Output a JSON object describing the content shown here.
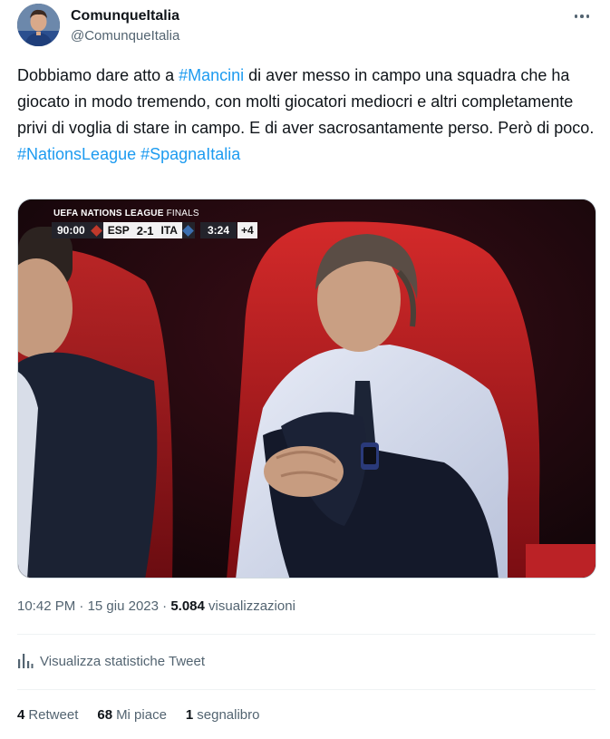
{
  "author": {
    "display_name": "ComunqueItalia",
    "handle": "@ComunqueItalia",
    "avatar_icon": "avatar-photo"
  },
  "more_icon": "more-horizontal-icon",
  "tweet": {
    "segments": [
      {
        "text": "Dobbiamo dare atto a ",
        "type": "text"
      },
      {
        "text": "#Mancini",
        "type": "hashtag"
      },
      {
        "text": " di aver messo in campo una squadra che ha giocato in modo tremendo, con molti giocatori mediocri e altri completamente privi di voglia di stare in campo. E di aver sacrosantamente perso. Però di poco.",
        "type": "text"
      },
      {
        "text": "#NationsLeague",
        "type": "hashtag"
      },
      {
        "text": " ",
        "type": "text"
      },
      {
        "text": "#SpagnaItalia",
        "type": "hashtag"
      }
    ]
  },
  "media": {
    "scorebug": {
      "competition_bold": "UEFA NATIONS LEAGUE",
      "competition_thin": "FINALS",
      "match_time": "90:00",
      "home_team": "ESP",
      "score": "2-1",
      "away_team": "ITA",
      "stoppage_clock": "3:24",
      "added_time": "+4"
    }
  },
  "meta": {
    "time": "10:42 PM",
    "separator": "·",
    "date": "15 giu 2023",
    "views_count": "5.084",
    "views_label": "visualizzazioni"
  },
  "analytics": {
    "label": "Visualizza statistiche Tweet",
    "icon": "analytics-bars-icon"
  },
  "stats": {
    "retweets_count": "4",
    "retweets_label": "Retweet",
    "likes_count": "68",
    "likes_label": "Mi piace",
    "bookmarks_count": "1",
    "bookmarks_label": "segnalibro"
  },
  "colors": {
    "link": "#1d9bf0",
    "text": "#0f1419",
    "secondary": "#536471"
  }
}
